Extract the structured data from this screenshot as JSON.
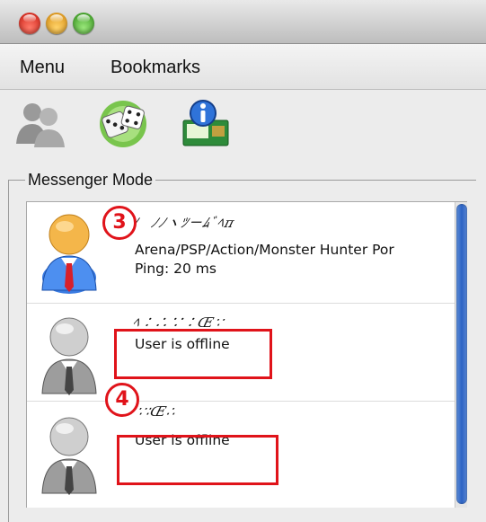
{
  "menu": {
    "items": [
      "Menu",
      "Bookmarks"
    ]
  },
  "toolbar": {
    "icons": [
      "users-icon",
      "dice-icon",
      "info-icon"
    ]
  },
  "panel": {
    "legend": "Messenger Mode"
  },
  "contacts": [
    {
      "name": "ﾉㅤﾉﾉヽﾂㄧﾑﾞﾍπ",
      "line1": "Arena/PSP/Action/Monster Hunter Por",
      "line2": "Ping: 20 ms",
      "online": true
    },
    {
      "name": "ﾍ∶∴∵∶Œ∵",
      "status": "User is offline",
      "online": false
    },
    {
      "name": "∵∶Œ∴",
      "status": "User is offline",
      "online": false
    }
  ],
  "annotations": {
    "marker_3": "3",
    "marker_4": "4"
  },
  "colors": {
    "accent_red": "#e0131a",
    "scroll_blue": "#2c63c4"
  }
}
